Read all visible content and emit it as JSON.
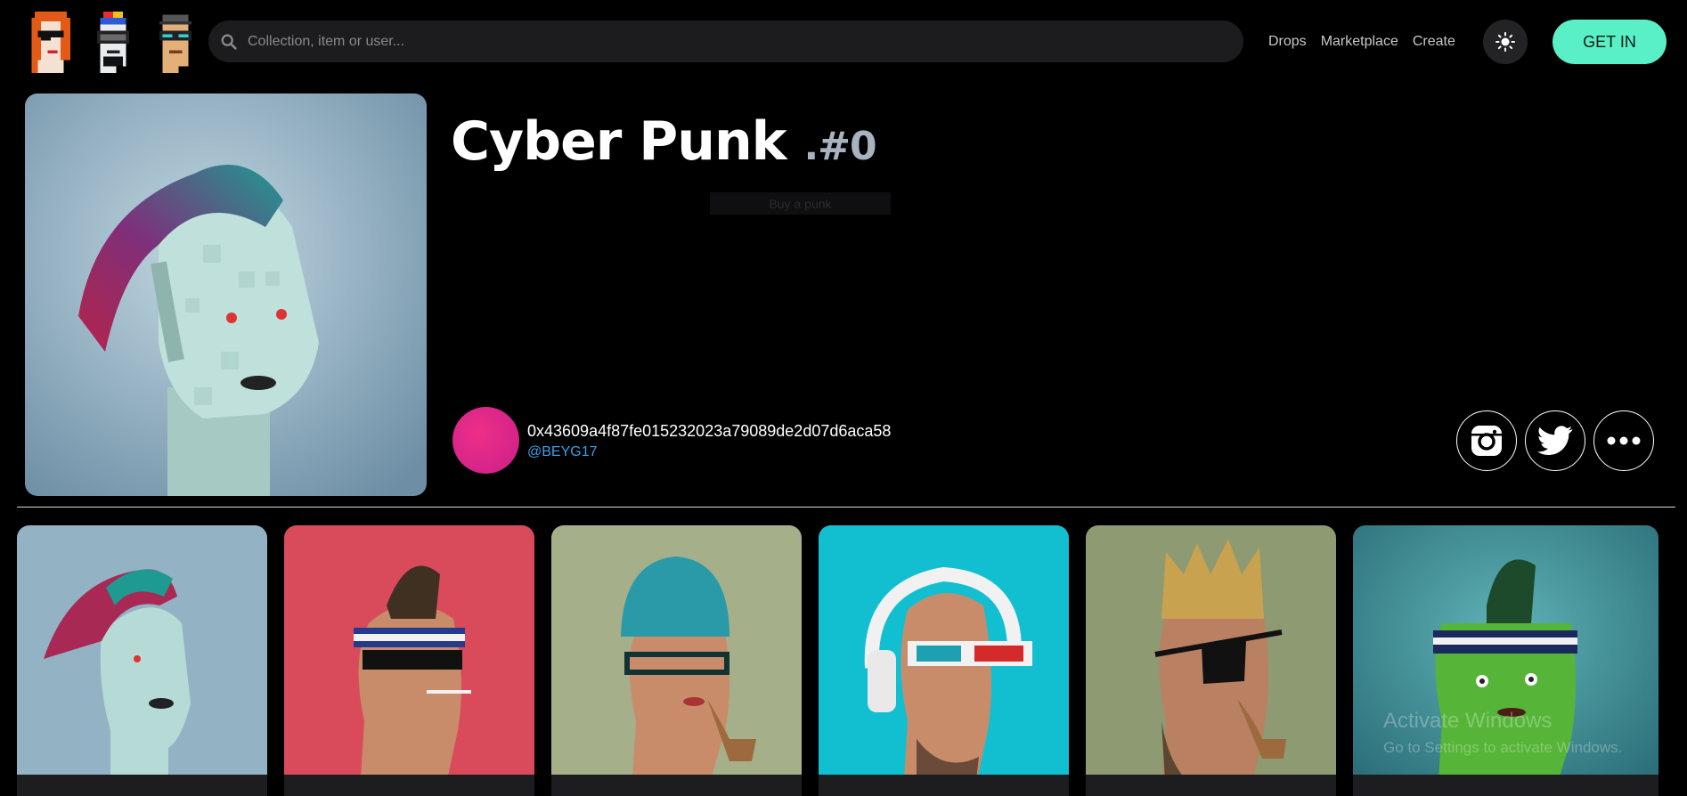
{
  "header": {
    "logos": [
      "punk-1",
      "punk-2",
      "punk-3"
    ],
    "search_placeholder": "Collection, item or user...",
    "nav": [
      "Drops",
      "Marketplace",
      "Create"
    ],
    "theme_icon": "sun-icon",
    "cta": "GET IN"
  },
  "hero": {
    "title": "Cyber Punk",
    "token": ".#0",
    "ghost_label": "Buy a punk",
    "creator": {
      "address": "0x43609a4f87fe015232023a79089de2d07d6aca58",
      "handle": "@BEYG17"
    },
    "social": [
      "instagram-icon",
      "twitter-icon",
      "more-icon"
    ]
  },
  "cards": [
    {
      "bg": "#9db8c8",
      "name": "mohawk-pink"
    },
    {
      "bg": "#d94b5a",
      "name": "headband-sunglasses"
    },
    {
      "bg": "#a9b48c",
      "name": "beanie-glasses"
    },
    {
      "bg": "#0fc0d0",
      "name": "headphones-3d"
    },
    {
      "bg": "#8d9a74",
      "name": "crown-eyepatch"
    },
    {
      "bg": "#3e8e96",
      "name": "green-headband"
    }
  ],
  "watermark": {
    "line1": "Activate Windows",
    "line2": "Go to Settings to activate Windows."
  },
  "colors": {
    "accent": "#5af0c7",
    "link": "#3aa0e8",
    "avatar": "#e92a88"
  }
}
